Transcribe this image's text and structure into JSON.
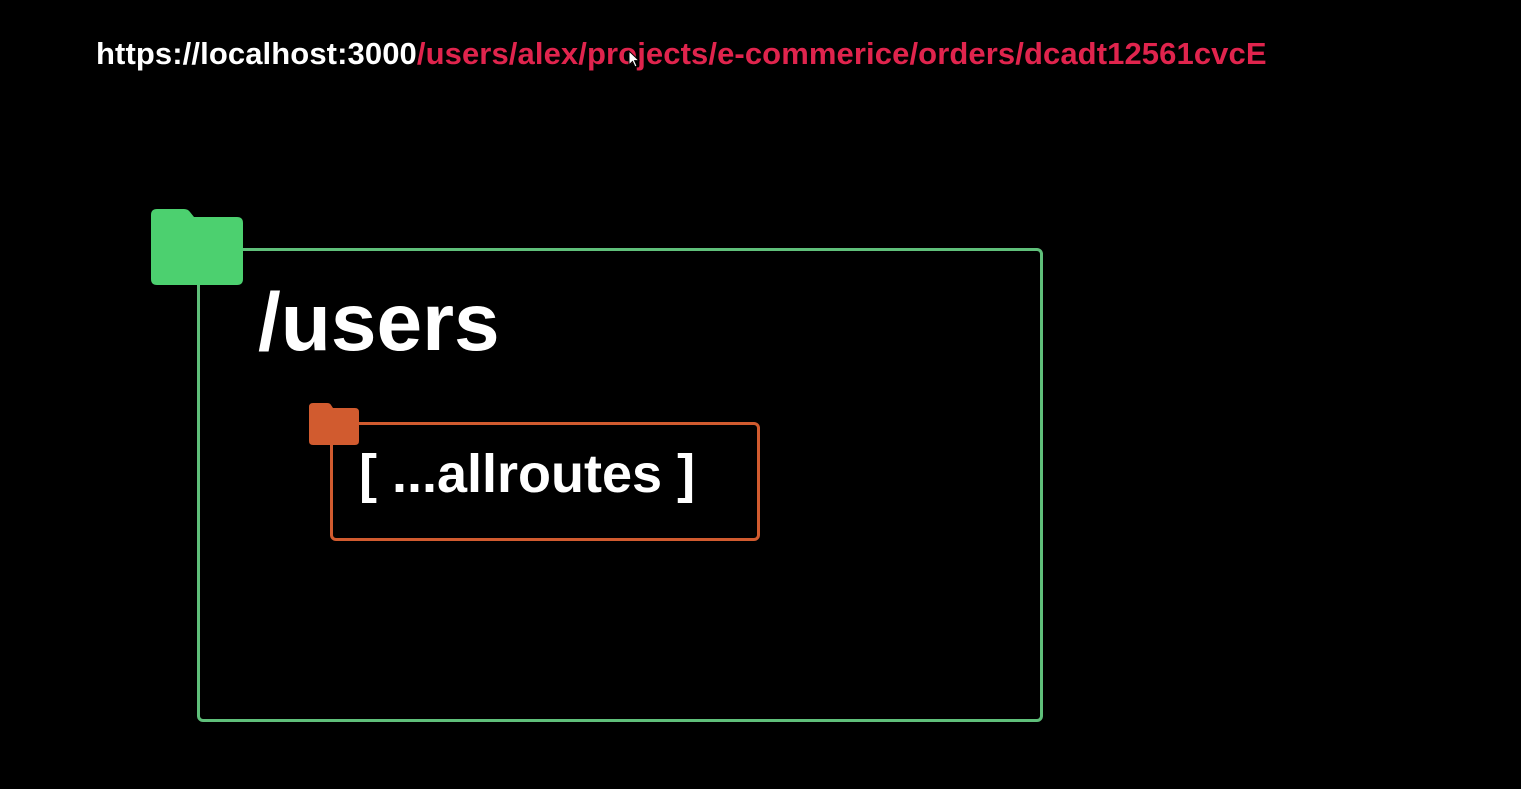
{
  "url": {
    "base": "https://localhost:3000",
    "path": "/users/alex/projects/e-commerice/orders/dcadt12561cvcE"
  },
  "colors": {
    "url_path": "#e0244d",
    "outer_folder": "#4cd06f",
    "outer_border": "#5fbf7a",
    "inner_folder": "#d15b2f",
    "inner_border": "#d15b2f"
  },
  "diagram": {
    "outer_folder": {
      "label": "/users",
      "icon": "folder-icon"
    },
    "inner_folder": {
      "label": "[ ...allroutes ]",
      "icon": "folder-icon"
    }
  },
  "cursor": {
    "icon": "mouse-pointer-icon"
  }
}
